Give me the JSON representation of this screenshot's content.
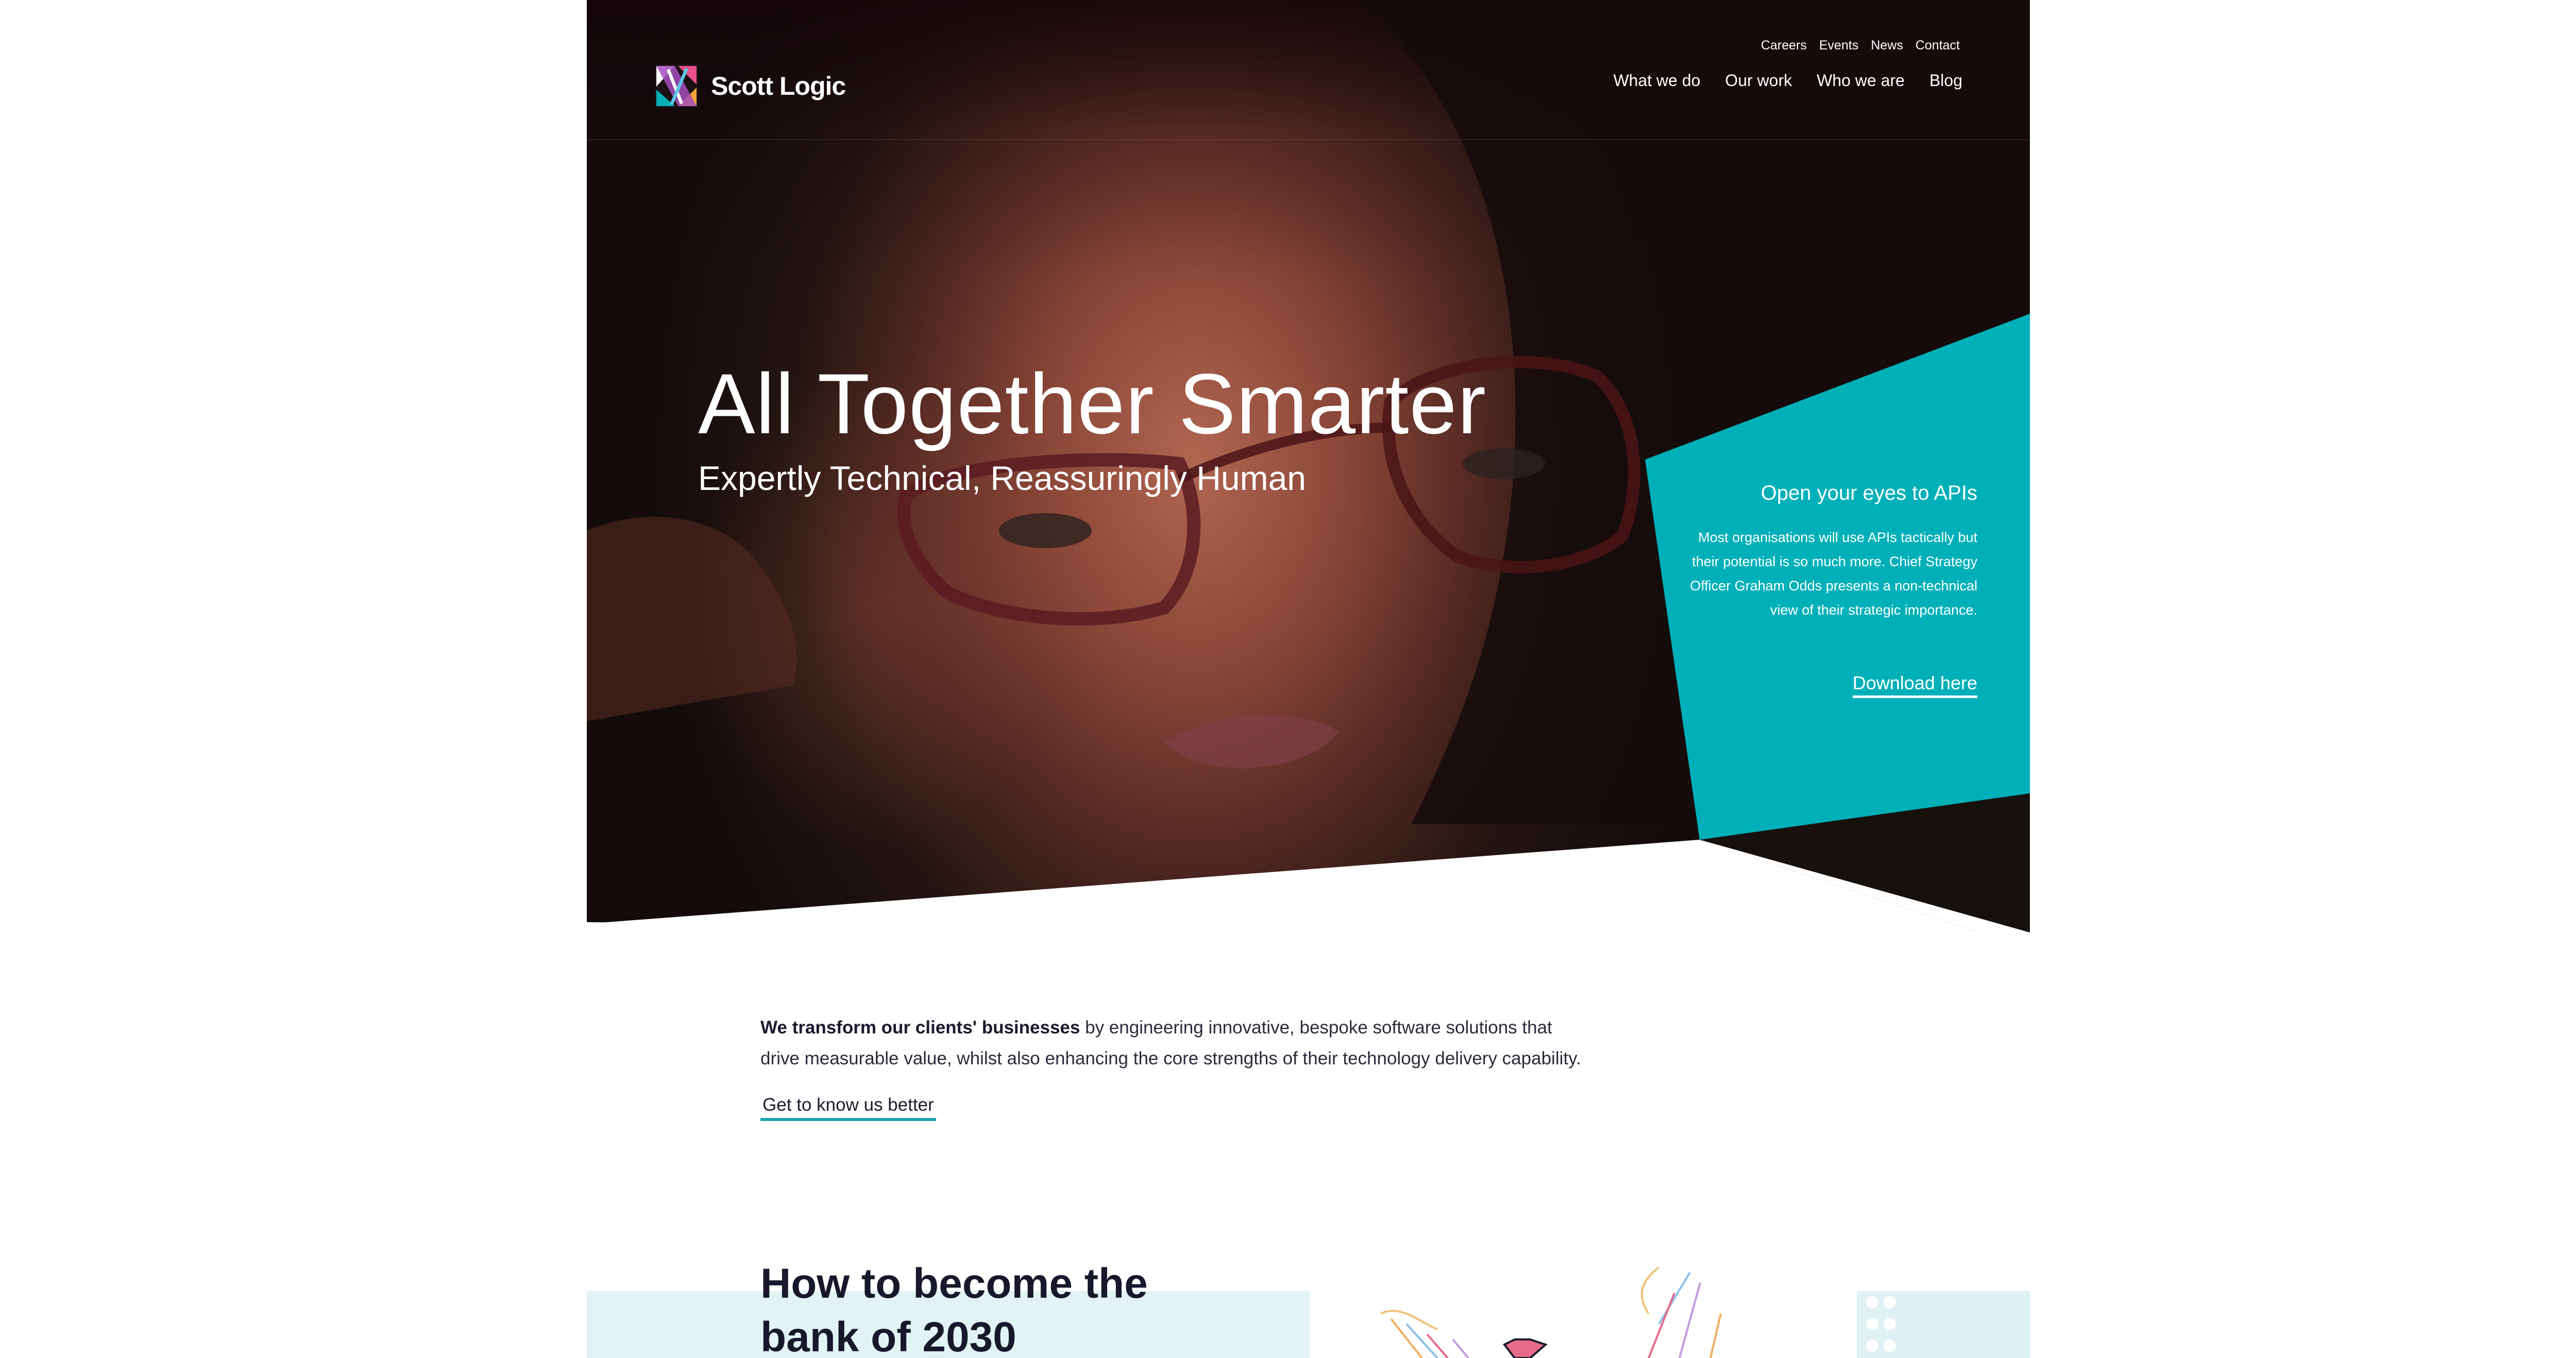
{
  "brand": {
    "name": "Scott Logic"
  },
  "utility_nav": [
    "Careers",
    "Events",
    "News",
    "Contact"
  ],
  "main_nav": [
    "What we do",
    "Our work",
    "Who we are",
    "Blog"
  ],
  "hero": {
    "title": "All Together Smarter",
    "subtitle": "Expertly Technical, Reassuringly Human"
  },
  "promo": {
    "title": "Open your eyes to APIs",
    "body": "Most organisations will use APIs tactically but their potential is so much more. Chief Strategy Officer Graham Odds presents a non-technical view of their strategic importance.",
    "link": "Download here"
  },
  "intro": {
    "bold": "We transform our clients' businesses",
    "rest": " by engineering innovative, bespoke software solutions that drive measurable value, whilst also enhancing the core strengths of their technology delivery capability.",
    "link": "Get to know us better"
  },
  "feature": {
    "title": "How to become the bank of 2030"
  },
  "colors": {
    "accent": "#00b0b9",
    "dark": "#17182b",
    "band": "#e1f3f4"
  },
  "icons": {
    "logo": "scott-logic-logo-icon"
  }
}
